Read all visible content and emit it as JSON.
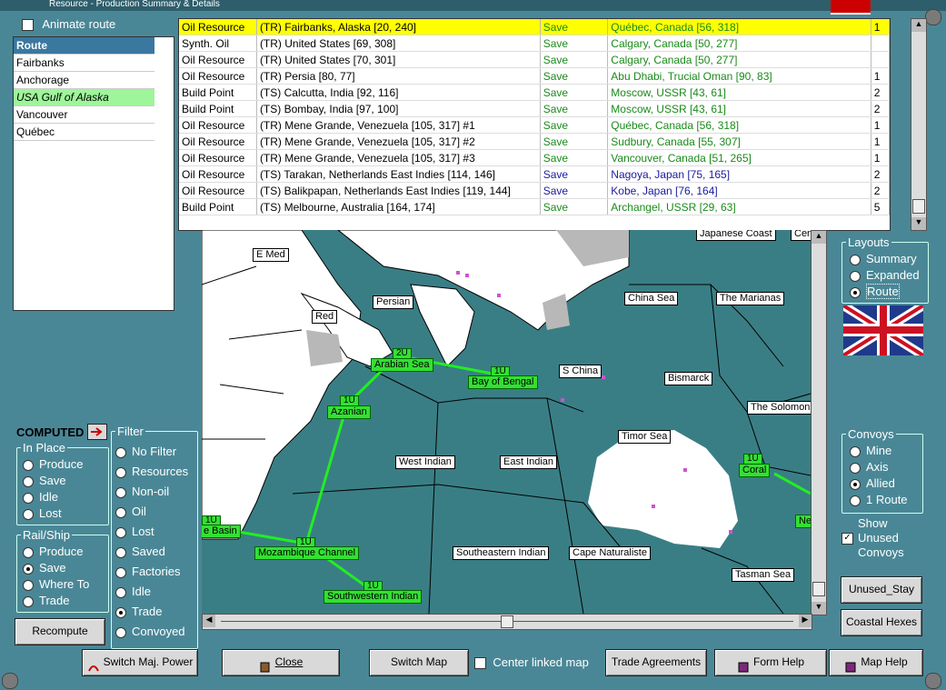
{
  "window": {
    "title": "Resource - Production Summary & Details"
  },
  "animate_route": {
    "label": "Animate route"
  },
  "route_panel": {
    "header": "Route",
    "items": [
      {
        "label": "Fairbanks",
        "highlight": false
      },
      {
        "label": "Anchorage",
        "highlight": false
      },
      {
        "label": "USA Gulf of Alaska",
        "highlight": true
      },
      {
        "label": "Vancouver",
        "highlight": false
      },
      {
        "label": "Québec",
        "highlight": false
      }
    ]
  },
  "table": {
    "rows": [
      {
        "type": "Oil Resource",
        "origin": "(TR) Fairbanks, Alaska [20, 240]",
        "status": "Save",
        "dest": "Québec, Canada [56, 318]",
        "count": "1",
        "selected": true,
        "color": "green"
      },
      {
        "type": "Synth. Oil",
        "origin": "(TR) United States [69, 308]",
        "status": "Save",
        "dest": "Calgary, Canada [50, 277]",
        "count": "",
        "selected": false,
        "color": "green"
      },
      {
        "type": "Oil Resource",
        "origin": "(TR) United States [70, 301]",
        "status": "Save",
        "dest": "Calgary, Canada [50, 277]",
        "count": "",
        "selected": false,
        "color": "green"
      },
      {
        "type": "Oil Resource",
        "origin": "(TR) Persia [80, 77]",
        "status": "Save",
        "dest": "Abu Dhabi, Trucial Oman [90, 83]",
        "count": "1",
        "selected": false,
        "color": "green"
      },
      {
        "type": "Build Point",
        "origin": "(TS) Calcutta, India [92, 116]",
        "status": "Save",
        "dest": "Moscow, USSR [43, 61]",
        "count": "2",
        "selected": false,
        "color": "green"
      },
      {
        "type": "Build Point",
        "origin": "(TS) Bombay, India [97, 100]",
        "status": "Save",
        "dest": "Moscow, USSR [43, 61]",
        "count": "2",
        "selected": false,
        "color": "green"
      },
      {
        "type": "Oil Resource",
        "origin": "(TR) Mene Grande, Venezuela [105, 317] #1",
        "status": "Save",
        "dest": "Québec, Canada [56, 318]",
        "count": "1",
        "selected": false,
        "color": "green"
      },
      {
        "type": "Oil Resource",
        "origin": "(TR) Mene Grande, Venezuela [105, 317] #2",
        "status": "Save",
        "dest": "Sudbury, Canada [55, 307]",
        "count": "1",
        "selected": false,
        "color": "green"
      },
      {
        "type": "Oil Resource",
        "origin": "(TR) Mene Grande, Venezuela [105, 317] #3",
        "status": "Save",
        "dest": "Vancouver, Canada [51, 265]",
        "count": "1",
        "selected": false,
        "color": "green"
      },
      {
        "type": "Oil Resource",
        "origin": "(TS) Tarakan, Netherlands East Indies [114, 146]",
        "status": "Save",
        "dest": "Nagoya, Japan [75, 165]",
        "count": "2",
        "selected": false,
        "color": "blue"
      },
      {
        "type": "Oil Resource",
        "origin": "(TS) Balikpapan, Netherlands East Indies [119, 144]",
        "status": "Save",
        "dest": "Kobe, Japan [76, 164]",
        "count": "2",
        "selected": false,
        "color": "blue"
      },
      {
        "type": "Build Point",
        "origin": "(TS) Melbourne, Australia [164, 174]",
        "status": "Save",
        "dest": "Archangel, USSR [29, 63]",
        "count": "5",
        "selected": false,
        "color": "green"
      }
    ]
  },
  "map": {
    "sea_labels": {
      "e_med": "E Med",
      "persian": "Persian",
      "red": "Red",
      "arabian_sea": "Arabian Sea",
      "bay_of_bengal": "Bay of Bengal",
      "azanian": "Azanian",
      "s_china": "S China",
      "china_sea": "China Sea",
      "marianas": "The Marianas",
      "japanese_coast": "Japanese Coast",
      "cen": "Cen",
      "bismarck": "Bismarck",
      "solomons": "The Solomons",
      "timor_sea": "Timor Sea",
      "west_indian": "West Indian",
      "east_indian": "East Indian",
      "coral": "Coral",
      "ne": "Ne",
      "basin": "e Basin",
      "mozambique": "Mozambique Channel",
      "southeastern_indian": "Southeastern Indian",
      "cape_naturaliste": "Cape Naturaliste",
      "tasman_sea": "Tasman Sea",
      "southwestern_indian": "Southwestern Indian"
    },
    "badges": {
      "arabian": "2U",
      "bengal": "1U",
      "azanian": "1U",
      "coral": "1U",
      "basin": "1U",
      "mozambique": "1U",
      "southwestern": "1U"
    }
  },
  "layouts": {
    "title": "Layouts",
    "options": [
      "Summary",
      "Expanded",
      "Route"
    ],
    "selected": "Route"
  },
  "convoys": {
    "title": "Convoys",
    "options": [
      "Mine",
      "Axis",
      "Allied",
      "1 Route"
    ],
    "selected": "Allied"
  },
  "show_unused": {
    "line1": "Show",
    "line2": "Unused",
    "line3": "Convoys",
    "checked": true
  },
  "computed": {
    "label": "COMPUTED"
  },
  "in_place": {
    "title": "In Place",
    "options": [
      "Produce",
      "Save",
      "Idle",
      "Lost"
    ]
  },
  "rail_ship": {
    "title": "Rail/Ship",
    "options": [
      "Produce",
      "Save",
      "Where To",
      "Trade"
    ],
    "selected": "Save"
  },
  "filter": {
    "title": "Filter",
    "options": [
      "No Filter",
      "Resources",
      "Non-oil",
      "Oil",
      "Lost",
      "Saved",
      "Factories",
      "Idle",
      "Trade",
      "Convoyed"
    ],
    "selected": "Trade"
  },
  "buttons": {
    "recompute": "Recompute",
    "switch_major_power": "Switch Maj. Power",
    "close": "Close",
    "switch_map": "Switch Map",
    "center_linked_map": "Center linked map",
    "trade_agreements": "Trade Agreements",
    "form_help": "Form Help",
    "map_help": "Map Help",
    "unused_stay": "Unused_Stay",
    "coastal_hexes": "Coastal Hexes"
  },
  "colors": {
    "land": "#ffffff",
    "sea": "#3a7e85",
    "route": "#22ee22",
    "selected_row": "#ffff00"
  }
}
